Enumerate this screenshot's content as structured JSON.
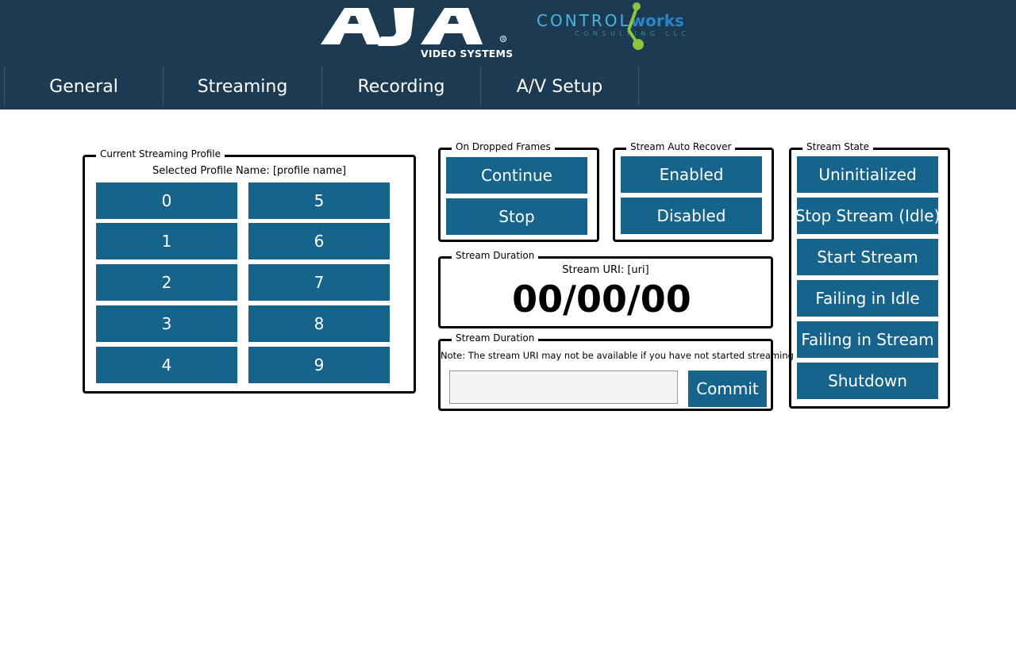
{
  "header": {
    "aja_logo_text": "AJA",
    "aja_logo_sub": "VIDEO SYSTEMS",
    "cw_control": "CONTROL",
    "cw_works": "works",
    "cw_consulting": "CONSULTING LLC",
    "colors": {
      "background": "#1c3a52",
      "accent": "#16638b"
    }
  },
  "nav": {
    "tabs": [
      {
        "label": "General"
      },
      {
        "label": "Streaming"
      },
      {
        "label": "Recording"
      },
      {
        "label": "A/V Setup"
      }
    ]
  },
  "profile": {
    "legend": "Current Streaming Profile",
    "selected_label": "Selected Profile Name: [profile name]",
    "buttons": [
      "0",
      "1",
      "2",
      "3",
      "4",
      "5",
      "6",
      "7",
      "8",
      "9"
    ]
  },
  "dropped_frames": {
    "legend": "On Dropped Frames",
    "continue_label": "Continue",
    "stop_label": "Stop"
  },
  "auto_recover": {
    "legend": "Stream Auto Recover",
    "enabled_label": "Enabled",
    "disabled_label": "Disabled"
  },
  "duration": {
    "legend": "Stream Duration",
    "uri_label": "Stream URI: [uri]",
    "time": "00/00/00"
  },
  "uri_commit": {
    "legend": "Stream Duration",
    "note": "Note: The stream URI may not be available if you have not started streaming",
    "input_value": "",
    "commit_label": "Commit"
  },
  "stream_state": {
    "legend": "Stream State",
    "buttons": [
      "Uninitialized",
      "Stop Stream (Idle)",
      "Start Stream",
      "Failing in Idle",
      "Failing in Stream",
      "Shutdown"
    ]
  }
}
